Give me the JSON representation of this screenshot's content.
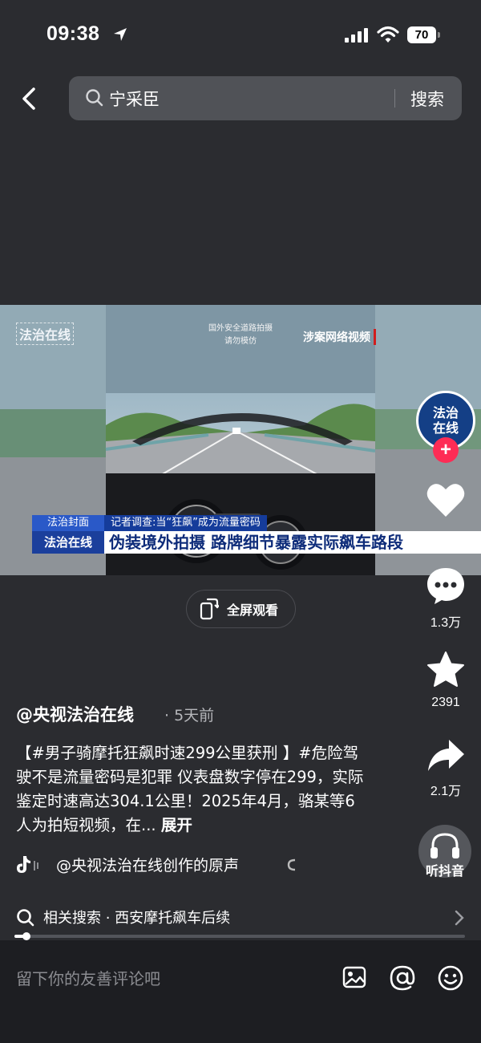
{
  "status_bar": {
    "time": "09:38",
    "battery": "70"
  },
  "search": {
    "query": "宁采臣",
    "button": "搜索"
  },
  "video": {
    "watermark_logo": "法治在线",
    "watermark_note_line1": "国外安全道路拍摄",
    "watermark_note_line2": "请勿模仿",
    "watermark_tag": "涉案网络视频",
    "ticker_label_top": "法治封面",
    "ticker_label_bottom": "法治在线",
    "ticker_subtitle": "记者调查:当“狂飙”成为流量密码",
    "ticker_headline": "伪装境外拍摄 路牌细节暴露实际飙车路段"
  },
  "fullscreen_label": "全屏观看",
  "rail": {
    "avatar_text_line1": "法治",
    "avatar_text_line2": "在线",
    "comments": "1.3万",
    "favorites": "2391",
    "shares": "2.1万",
    "listen": "听抖音"
  },
  "post": {
    "author": "@央视法治在线",
    "time_ago": "· 5天前",
    "description": "【#男子骑摩托狂飙时速299公里获刑 】#危险驾驶不是流量密码是犯罪 仪表盘数字停在299，实际鉴定时速高达304.1公里！2025年4月，骆某等6人为拍短视频，在...",
    "expand": "展开",
    "sound": "@央视法治在线创作的原声"
  },
  "related": {
    "text": "相关搜索 · 西安摩托飙车后续"
  },
  "progress": 0.03,
  "comment_placeholder": "留下你的友善评论吧"
}
